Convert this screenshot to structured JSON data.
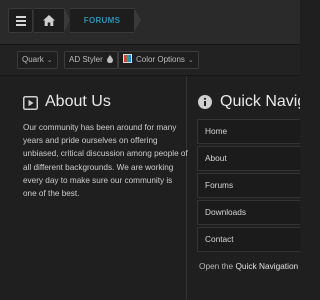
{
  "breadcrumb": {
    "home_icon": "home-icon",
    "current": "FORUMS"
  },
  "toolbar": {
    "style_selector": "Quark",
    "ad_styler": "AD Styler",
    "color_options": "Color Options"
  },
  "about": {
    "icon": "play-square-icon",
    "title": "About Us",
    "text": "Our community has been around for many years and pride ourselves on offering unbiased, critical discussion among people of all different backgrounds. We are working every day to make sure our community is one of the best."
  },
  "quick_nav": {
    "icon": "info-circle-icon",
    "title": "Quick Navigation",
    "items": [
      "Home",
      "About",
      "Forums",
      "Downloads",
      "Contact"
    ],
    "footer_prefix": "Open the",
    "footer_link": "Quick Navigation"
  },
  "colors": {
    "accent": "#2f8fb6",
    "background": "#1f1f1f"
  }
}
